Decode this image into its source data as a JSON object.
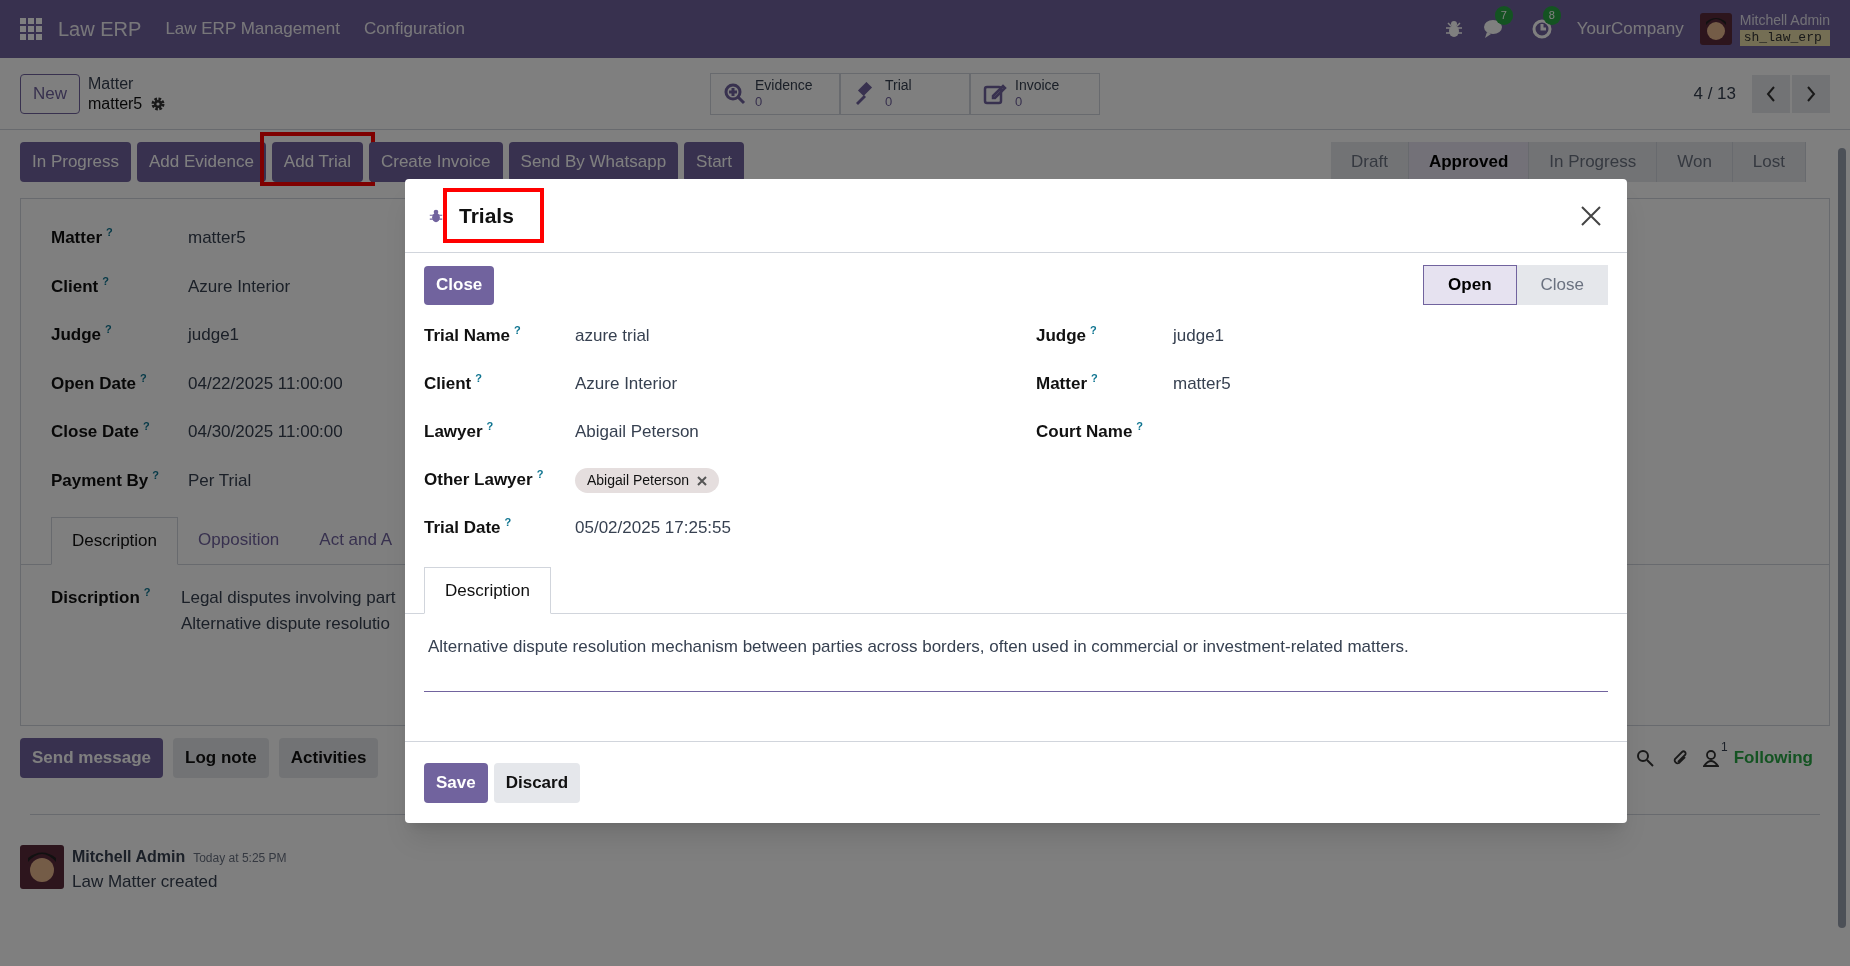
{
  "navbar": {
    "app_name": "Law ERP",
    "menus": [
      "Law ERP Management",
      "Configuration"
    ],
    "chat_count": "7",
    "activity_count": "8",
    "company": "YourCompany",
    "user": "Mitchell Admin",
    "database": "sh_law_erp"
  },
  "control_panel": {
    "new_button": "New",
    "breadcrumb": "Matter",
    "record": "matter5",
    "smart_buttons": [
      {
        "kind": "search",
        "label": "Evidence",
        "count": "0"
      },
      {
        "kind": "gavel",
        "label": "Trial",
        "count": "0"
      },
      {
        "kind": "edit",
        "label": "Invoice",
        "count": "0"
      }
    ],
    "pager": "4 / 13"
  },
  "actions": [
    {
      "label": "In Progress",
      "highlighted": false
    },
    {
      "label": "Add Evidence",
      "highlighted": false
    },
    {
      "label": "Add Trial",
      "highlighted": true
    },
    {
      "label": "Create Invoice",
      "highlighted": false
    },
    {
      "label": "Send By Whatsapp",
      "highlighted": false
    },
    {
      "label": "Start",
      "highlighted": false
    }
  ],
  "stages": [
    {
      "label": "Draft",
      "selected": false
    },
    {
      "label": "Approved",
      "selected": true
    },
    {
      "label": "In Progress",
      "selected": false
    },
    {
      "label": "Won",
      "selected": false
    },
    {
      "label": "Lost",
      "selected": false
    }
  ],
  "form": {
    "fields": [
      {
        "label": "Matter",
        "help": "?",
        "value": "matter5"
      },
      {
        "label": "Client",
        "help": "?",
        "value": "Azure Interior"
      },
      {
        "label": "Judge",
        "help": "?",
        "value": "judge1"
      },
      {
        "label": "Open Date",
        "help": "?",
        "value": "04/22/2025 11:00:00"
      },
      {
        "label": "Close Date",
        "help": "?",
        "value": "04/30/2025 11:00:00"
      },
      {
        "label": "Payment By",
        "help": "?",
        "value": "Per Trial"
      }
    ],
    "tabs": [
      {
        "label": "Description",
        "selected": true
      },
      {
        "label": "Opposition",
        "selected": false
      },
      {
        "label": "Act and A",
        "selected": false
      }
    ],
    "description_label": "Discription",
    "description_help": "?",
    "description_lines": [
      "Legal disputes involving part",
      "Alternative dispute resolutio"
    ]
  },
  "chatter": {
    "buttons": [
      {
        "label": "Send message",
        "selected": true
      },
      {
        "label": "Log note",
        "selected": false
      },
      {
        "label": "Activities",
        "selected": false
      }
    ],
    "followers": "1",
    "follow_label": "Following",
    "messages": [
      {
        "author": "Mitchell Admin",
        "time": "Today at 5:25 PM",
        "body": "Law Matter created"
      }
    ]
  },
  "dialog": {
    "title": "Trials",
    "title_highlighted": true,
    "close_button": "Close",
    "stages": [
      {
        "label": "Open",
        "selected": true
      },
      {
        "label": "Close",
        "selected": false
      }
    ],
    "left_fields": [
      {
        "label": "Trial Name",
        "help": "?",
        "value": "azure trial"
      },
      {
        "label": "Client",
        "help": "?",
        "value": "Azure Interior"
      },
      {
        "label": "Lawyer",
        "help": "?",
        "value": "Abigail Peterson"
      },
      {
        "label": "Other Lawyer",
        "help": "?",
        "tags": [
          "Abigail Peterson"
        ]
      },
      {
        "label": "Trial Date",
        "help": "?",
        "value": "05/02/2025 17:25:55"
      }
    ],
    "right_fields": [
      {
        "label": "Judge",
        "help": "?",
        "value": "judge1"
      },
      {
        "label": "Matter",
        "help": "?",
        "value": "matter5"
      },
      {
        "label": "Court Name",
        "help": "?"
      }
    ],
    "tabs": [
      {
        "label": "Description",
        "selected": true
      }
    ],
    "description": "Alternative dispute resolution mechanism between parties across borders, often used in commercial or investment-related matters.",
    "footer_buttons": [
      {
        "label": "Save",
        "kind": "primary"
      },
      {
        "label": "Discard",
        "kind": "secondary"
      }
    ]
  }
}
